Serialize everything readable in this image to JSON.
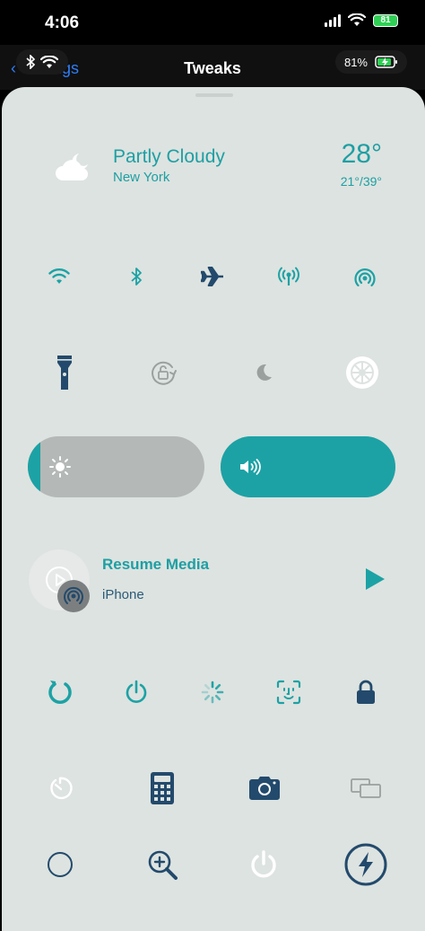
{
  "status_bar": {
    "time": "4:06",
    "battery_level": "81"
  },
  "nav": {
    "back_label": "Settings",
    "title": "Tweaks",
    "battery_percent": "81%"
  },
  "weather": {
    "condition": "Partly Cloudy",
    "city": "New York",
    "temperature": "28°",
    "range": "21°/39°"
  },
  "toggles_row1": [
    {
      "icon": "wifi-icon",
      "active": true
    },
    {
      "icon": "bluetooth-icon",
      "active": true
    },
    {
      "icon": "airplane-icon",
      "active": true
    },
    {
      "icon": "cellular-antenna-icon",
      "active": true
    },
    {
      "icon": "airdrop-icon",
      "active": true
    }
  ],
  "toggles_row2": [
    {
      "icon": "flashlight-icon",
      "active": true
    },
    {
      "icon": "rotation-lock-icon",
      "active": false
    },
    {
      "icon": "moon-icon",
      "active": false
    },
    {
      "icon": "settings-gear-icon",
      "active": false
    }
  ],
  "sliders": {
    "brightness": 0.07,
    "volume": 1.0
  },
  "media": {
    "title": "Resume Media",
    "device": "iPhone"
  },
  "toggles_row3": [
    {
      "icon": "respring-icon"
    },
    {
      "icon": "power-icon"
    },
    {
      "icon": "loading-spinner-icon"
    },
    {
      "icon": "face-id-icon"
    },
    {
      "icon": "lock-icon"
    }
  ],
  "toggles_row4": [
    {
      "icon": "timer-icon"
    },
    {
      "icon": "calculator-icon"
    },
    {
      "icon": "camera-icon"
    },
    {
      "icon": "screen-mirroring-icon"
    }
  ],
  "toggles_row5": [
    {
      "icon": "circle-icon"
    },
    {
      "icon": "magnifier-icon"
    },
    {
      "icon": "power-off-icon"
    },
    {
      "icon": "low-power-icon"
    }
  ],
  "colors": {
    "teal": "#1ca2a5",
    "navy": "#234a6c",
    "panel": "#dde3e0",
    "gray": "#9aa09e"
  }
}
